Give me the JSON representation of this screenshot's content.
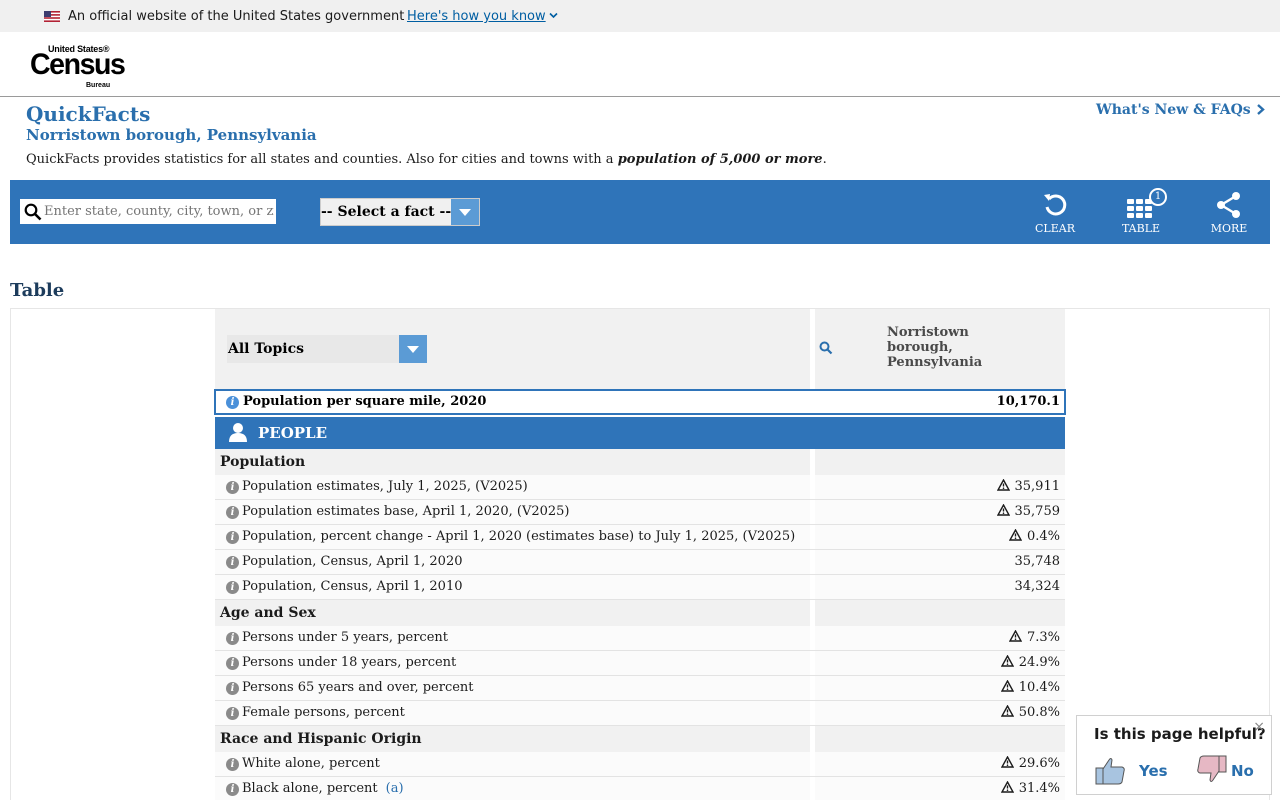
{
  "gov_banner": {
    "text": "An official website of the United States government",
    "link": "Here's how you know"
  },
  "logo": {
    "line1": "United States®",
    "line2": "Census",
    "line3": "Bureau"
  },
  "page": {
    "title": "QuickFacts",
    "subtitle": "Norristown borough, Pennsylvania",
    "description_prefix": "QuickFacts provides statistics for all states and counties. Also for cities and towns with a ",
    "description_emphasis": "population of 5,000 or more",
    "description_suffix": ".",
    "whats_new": "What's New & FAQs"
  },
  "toolbar": {
    "search_placeholder": "Enter state, county, city, town, or zip code",
    "fact_select": "-- Select a fact --",
    "clear_label": "CLEAR",
    "table_label": "TABLE",
    "table_badge": "1",
    "more_label": "MORE",
    "bg_color": "#2f74b9"
  },
  "table": {
    "heading": "Table",
    "topic_select": "All Topics",
    "location_column": "Norristown borough, Pennsylvania",
    "highlight": {
      "label": "Population per square mile, 2020",
      "value": "10,170.1"
    },
    "section": "PEOPLE",
    "rows": [
      {
        "type": "cat",
        "label": "Population"
      },
      {
        "label": "Population estimates, July 1, 2025, (V2025)",
        "value": "35,911",
        "warn": true
      },
      {
        "label": "Population estimates base, April 1, 2020, (V2025)",
        "value": "35,759",
        "warn": true
      },
      {
        "label": "Population, percent change - April 1, 2020 (estimates base) to July 1, 2025, (V2025)",
        "value": "0.4%",
        "warn": true
      },
      {
        "label": "Population, Census, April 1, 2020",
        "value": "35,748",
        "warn": false
      },
      {
        "label": "Population, Census, April 1, 2010",
        "value": "34,324",
        "warn": false
      },
      {
        "type": "cat",
        "label": "Age and Sex"
      },
      {
        "label": "Persons under 5 years, percent",
        "value": "7.3%",
        "warn": true
      },
      {
        "label": "Persons under 18 years, percent",
        "value": "24.9%",
        "warn": true
      },
      {
        "label": "Persons 65 years and over, percent",
        "value": "10.4%",
        "warn": true
      },
      {
        "label": "Female persons, percent",
        "value": "50.8%",
        "warn": true
      },
      {
        "type": "cat",
        "label": "Race and Hispanic Origin"
      },
      {
        "label": "White alone, percent",
        "value": "29.6%",
        "warn": true
      },
      {
        "label": "Black alone, percent",
        "value": "31.4%",
        "warn": true,
        "note": "(a)"
      }
    ]
  },
  "helpful": {
    "question": "Is this page helpful?",
    "yes": "Yes",
    "no": "No",
    "close": "×"
  }
}
